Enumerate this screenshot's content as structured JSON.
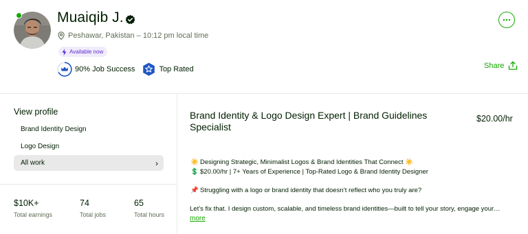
{
  "profile": {
    "name": "Muaiqib J.",
    "location": "Peshawar, Pakistan – 10:12 pm local time",
    "availability": "Available now",
    "job_success": "90% Job Success",
    "top_rated": "Top Rated"
  },
  "actions": {
    "share_label": "Share"
  },
  "sidebar": {
    "heading": "View profile",
    "items": [
      {
        "label": "Brand Identity Design"
      },
      {
        "label": "Logo Design"
      },
      {
        "label": "All work",
        "chevron": "›"
      }
    ]
  },
  "stats": [
    {
      "value": "$10K+",
      "label": "Total earnings"
    },
    {
      "value": "74",
      "label": "Total jobs"
    },
    {
      "value": "65",
      "label": "Total hours"
    }
  ],
  "main": {
    "title": "Brand Identity & Logo Design Expert | Brand Guidelines Specialist",
    "rate": "$20.00/hr",
    "lines": [
      {
        "emoji_left": "☀️",
        "text": "Designing Strategic, Minimalist Logos & Brand Identities That Connect",
        "emoji_right": "☀️"
      },
      {
        "emoji_left": "💲",
        "text": "$20.00/hr | 7+ Years of Experience | Top-Rated Logo & Brand Identity Designer"
      },
      {
        "emoji_left": "📌",
        "text": "Struggling with a logo or brand identity that doesn’t reflect who you truly are?"
      },
      {
        "text": "Let’s fix that. I design custom, scalable, and timeless brand identities—built to tell your story, engage your…"
      }
    ],
    "more_label": "more"
  },
  "colors": {
    "accent": "#14a800",
    "text": "#001e00",
    "muted": "#5e6d55",
    "badge_blue": "#1f57c3",
    "available_bg": "#f1ecfb",
    "available_text": "#5d2ecf"
  },
  "icons": {
    "verified": "verified-check-icon",
    "location": "location-pin-icon",
    "availability": "lightning-bolt-icon",
    "job_success": "crown-badge-icon",
    "top_rated": "star-badge-icon",
    "more": "ellipsis-icon",
    "share": "share-upload-icon"
  }
}
